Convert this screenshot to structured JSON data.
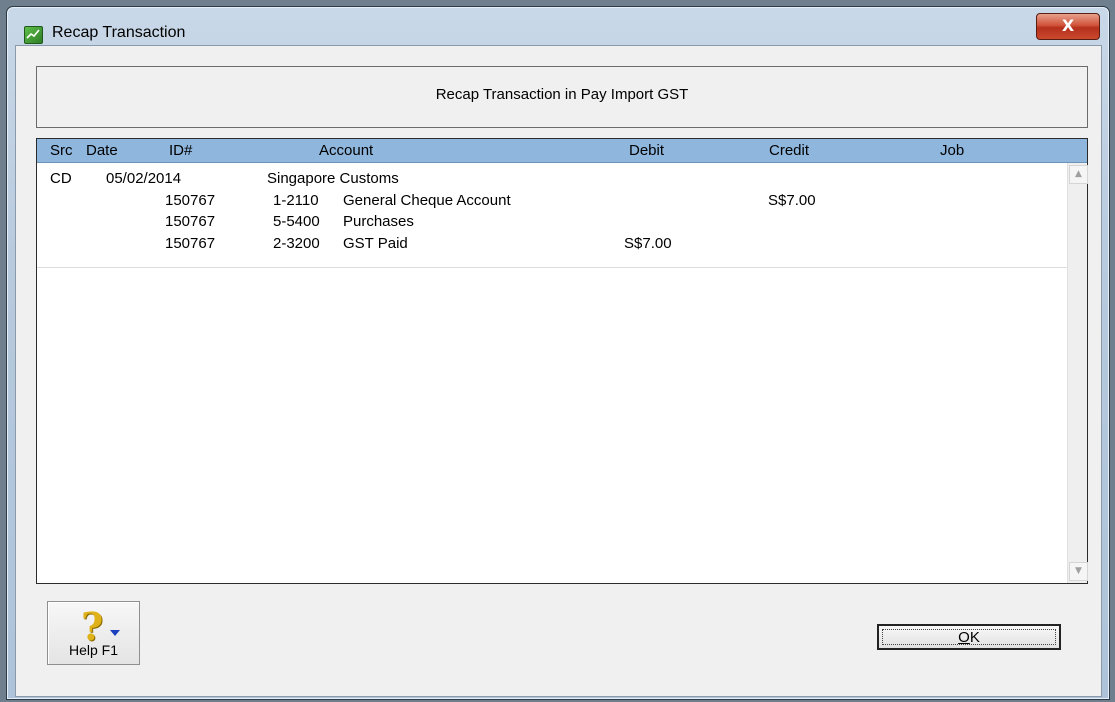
{
  "window": {
    "title": "Recap Transaction",
    "close_label": "X"
  },
  "header": {
    "title": "Recap Transaction in Pay Import GST"
  },
  "grid": {
    "columns": [
      "Src",
      "Date",
      "ID#",
      "Account",
      "Debit",
      "Credit",
      "Job"
    ],
    "rows": [
      {
        "src": "CD",
        "date": "05/02/2014",
        "id": "",
        "account_no": "Singapore Customs",
        "account_name": "",
        "debit": "",
        "credit": "",
        "job": ""
      },
      {
        "src": "",
        "date": "",
        "id": "150767",
        "account_no": "1-2110",
        "account_name": "General Cheque Account",
        "debit": "",
        "credit": "S$7.00",
        "job": ""
      },
      {
        "src": "",
        "date": "",
        "id": "150767",
        "account_no": "5-5400",
        "account_name": "Purchases",
        "debit": "",
        "credit": "",
        "job": ""
      },
      {
        "src": "",
        "date": "",
        "id": "150767",
        "account_no": "2-3200",
        "account_name": "GST Paid",
        "debit": "S$7.00",
        "credit": "",
        "job": ""
      }
    ]
  },
  "buttons": {
    "help_label": "Help F1",
    "ok_label_prefix": "",
    "ok_label_mnemonic": "O",
    "ok_label_rest": "K"
  },
  "colors": {
    "grid_header": "#8fb6dd",
    "close_button": "#c9492f"
  },
  "icons": [
    "app-icon",
    "close-icon",
    "help-icon",
    "scroll-up-icon",
    "scroll-down-icon"
  ]
}
